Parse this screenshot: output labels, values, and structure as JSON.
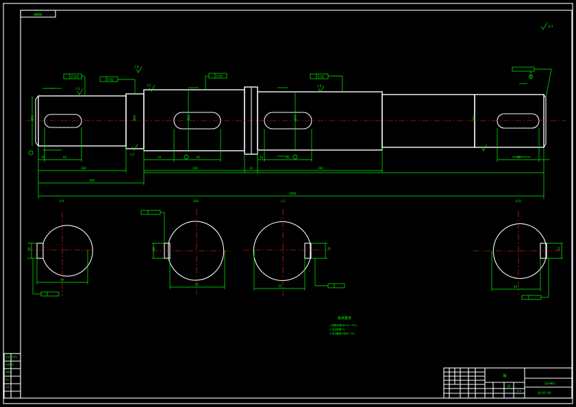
{
  "drawing": {
    "corner_tag": "装配图",
    "tolerance_frame_labels": [
      "0.025",
      "0.02",
      "0.04",
      "0.02"
    ],
    "dimensions": {
      "lengths": [
        "60",
        "160",
        "82",
        "160",
        "82",
        "18",
        "160",
        "14",
        "10",
        "80"
      ],
      "totals": [
        "358",
        "864",
        "1060"
      ],
      "diameters": [
        "Ø55",
        "Ø60",
        "Ø70",
        "Ø60",
        "Ø50"
      ],
      "roughness": [
        "1.6",
        "3.2",
        "1.6",
        "1.6",
        "3.2",
        "6.3"
      ]
    },
    "sections": [
      {
        "label": "A-A",
        "dim_bottom": "49",
        "key_width": "16"
      },
      {
        "label": "B-B",
        "dim_bottom": "53",
        "key_width": "18"
      },
      {
        "label": "C-C",
        "dim_bottom": "53",
        "key_width": "18"
      },
      {
        "label": "D-D",
        "dim_bottom": "44",
        "key_width": "14"
      }
    ],
    "technical_requirements": {
      "title": "技术要求",
      "lines": [
        "1.调质处理HB220~250。",
        "2.未注倒角C1。",
        "3.未注圆角半径R1~R2。"
      ]
    }
  },
  "title_block": {
    "part_name": "轴",
    "drawing_number": "JS-01-09",
    "material": "45",
    "scale": "1:2",
    "company": "设计单位"
  },
  "left_strip": {
    "items": [
      "借(通)用件登记",
      "旧底图总号",
      "底图总号",
      "签字",
      "日期"
    ]
  }
}
